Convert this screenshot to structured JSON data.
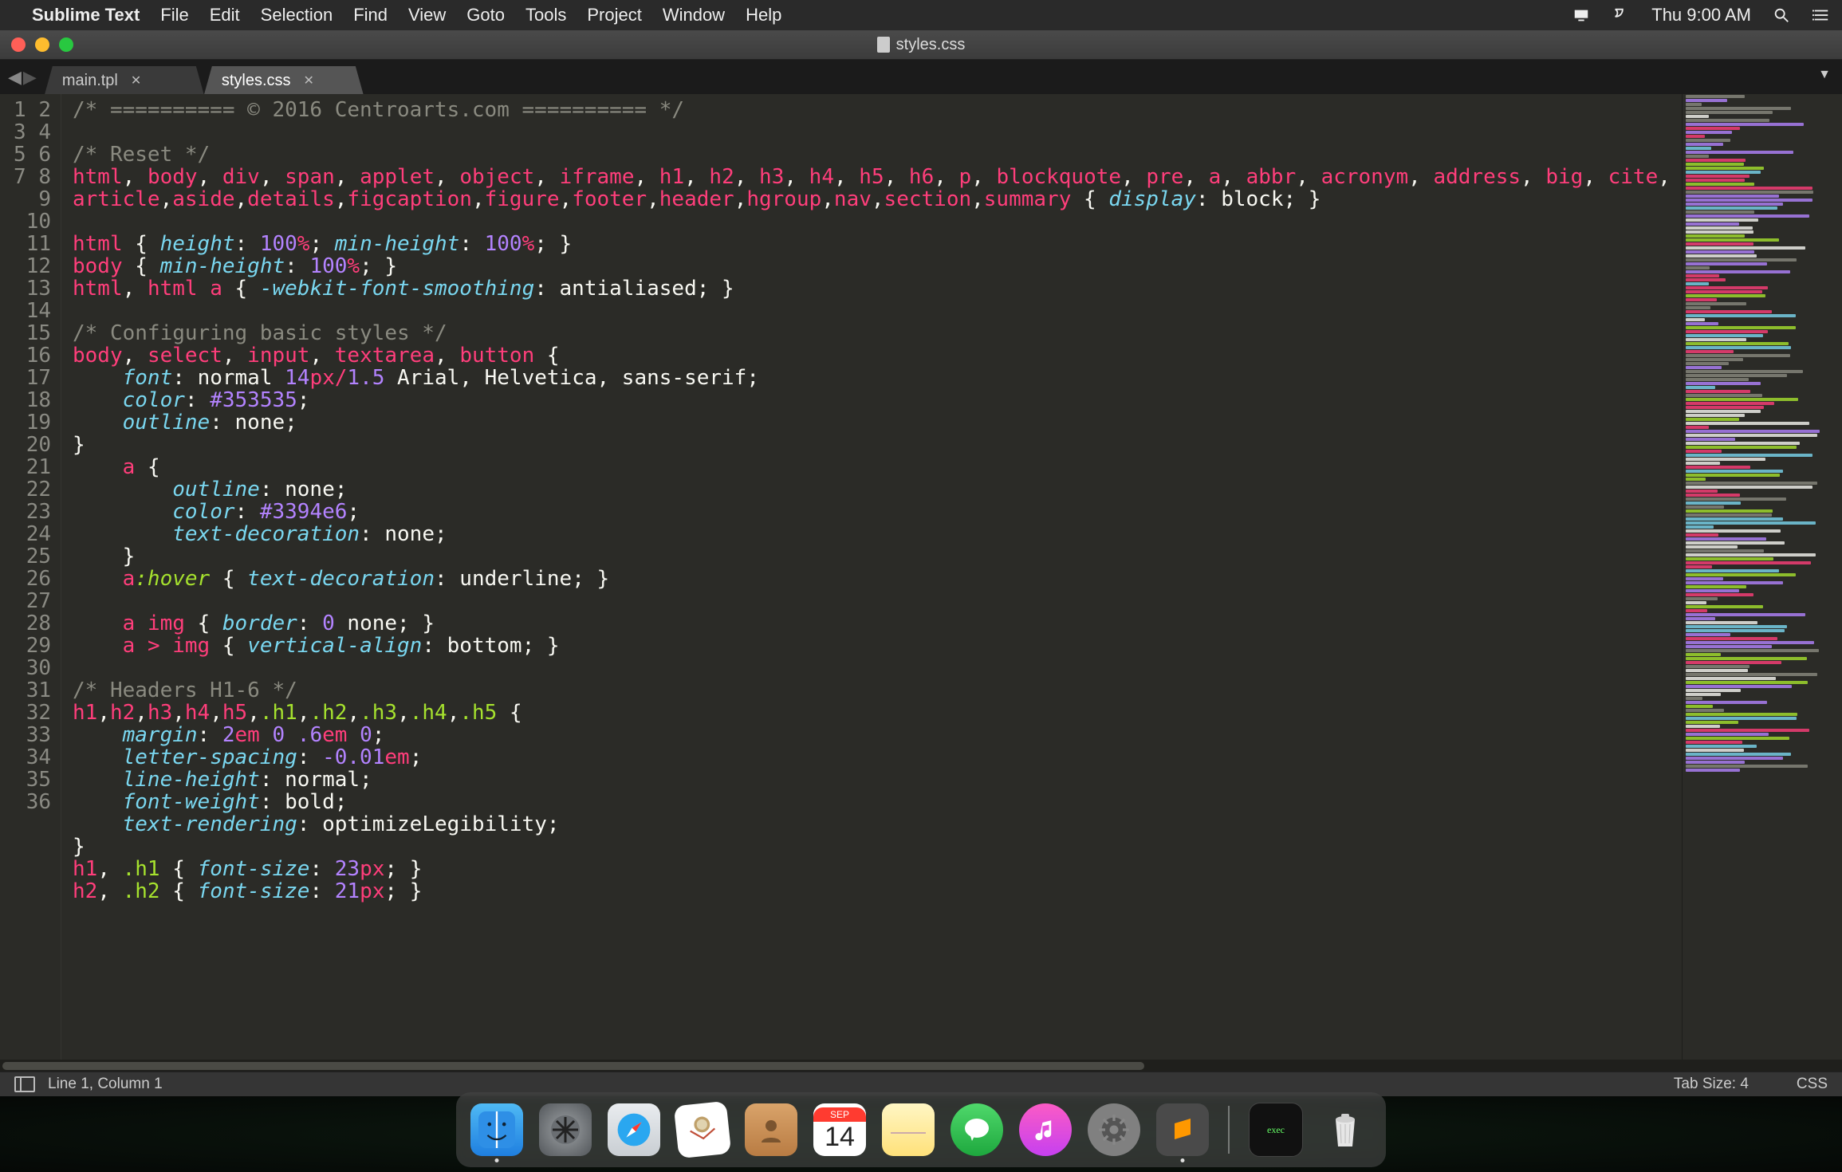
{
  "menubar": {
    "app_name": "Sublime Text",
    "items": [
      "File",
      "Edit",
      "Selection",
      "Find",
      "View",
      "Goto",
      "Tools",
      "Project",
      "Window",
      "Help"
    ],
    "clock": "Thu 9:00 AM"
  },
  "window": {
    "title_filename": "styles.css"
  },
  "tabs": [
    {
      "label": "main.tpl",
      "active": false
    },
    {
      "label": "styles.css",
      "active": true
    }
  ],
  "gutter": {
    "start": 1,
    "end": 36
  },
  "code_lines": [
    {
      "t": "comment",
      "text": "/* ========== © 2016 Centroarts.com ========== */"
    },
    {
      "t": "blank",
      "text": ""
    },
    {
      "t": "comment",
      "text": "/* Reset */"
    },
    {
      "t": "raw",
      "html": "<span class='sel'>html</span><span class='pn'>, </span><span class='sel'>body</span><span class='pn'>, </span><span class='sel'>div</span><span class='pn'>, </span><span class='sel'>span</span><span class='pn'>, </span><span class='sel'>applet</span><span class='pn'>, </span><span class='sel'>object</span><span class='pn'>, </span><span class='sel'>iframe</span><span class='pn'>, </span><span class='sel'>h1</span><span class='pn'>, </span><span class='sel'>h2</span><span class='pn'>, </span><span class='sel'>h3</span><span class='pn'>, </span><span class='sel'>h4</span><span class='pn'>, </span><span class='sel'>h5</span><span class='pn'>, </span><span class='sel'>h6</span><span class='pn'>, </span><span class='sel'>p</span><span class='pn'>, </span><span class='sel'>blockquote</span><span class='pn'>, </span><span class='sel'>pre</span><span class='pn'>, </span><span class='sel'>a</span><span class='pn'>, </span><span class='sel'>abbr</span><span class='pn'>, </span><span class='sel'>acronym</span><span class='pn'>, </span><span class='sel'>address</span><span class='pn'>, </span><span class='sel'>big</span><span class='pn'>, </span><span class='sel'>cite</span><span class='pn'>, </span><span class='sel'>code</span><span class='pn'>, </span>"
    },
    {
      "t": "raw",
      "html": "<span class='sel'>article</span><span class='pn'>,</span><span class='sel'>aside</span><span class='pn'>,</span><span class='sel'>details</span><span class='pn'>,</span><span class='sel'>figcaption</span><span class='pn'>,</span><span class='sel'>figure</span><span class='pn'>,</span><span class='sel'>footer</span><span class='pn'>,</span><span class='sel'>header</span><span class='pn'>,</span><span class='sel'>hgroup</span><span class='pn'>,</span><span class='sel'>nav</span><span class='pn'>,</span><span class='sel'>section</span><span class='pn'>,</span><span class='sel'>summary</span> <span class='pn'>{ </span><span class='prop'>display</span><span class='pn'>: </span><span class='val'>block</span><span class='pn'>; }</span>"
    },
    {
      "t": "blank",
      "text": ""
    },
    {
      "t": "raw",
      "html": "<span class='sel'>html</span> <span class='pn'>{ </span><span class='prop'>height</span><span class='pn'>: </span><span class='num'>100</span><span class='unit'>%</span><span class='pn'>; </span><span class='prop'>min-height</span><span class='pn'>: </span><span class='num'>100</span><span class='unit'>%</span><span class='pn'>; }</span>"
    },
    {
      "t": "raw",
      "html": "<span class='sel'>body</span> <span class='pn'>{ </span><span class='prop'>min-height</span><span class='pn'>: </span><span class='num'>100</span><span class='unit'>%</span><span class='pn'>; }</span>"
    },
    {
      "t": "raw",
      "html": "<span class='sel'>html</span><span class='pn'>, </span><span class='sel'>html</span> <span class='sel'>a</span> <span class='pn'>{ </span><span class='prop'>-webkit-font-smoothing</span><span class='pn'>: </span><span class='val'>antialiased</span><span class='pn'>; }</span>"
    },
    {
      "t": "blank",
      "text": ""
    },
    {
      "t": "comment",
      "text": "/* Configuring basic styles */"
    },
    {
      "t": "raw",
      "html": "<span class='sel'>body</span><span class='pn'>, </span><span class='sel'>select</span><span class='pn'>, </span><span class='sel'>input</span><span class='pn'>, </span><span class='sel'>textarea</span><span class='pn'>, </span><span class='sel'>button</span> <span class='pn'>{</span>"
    },
    {
      "t": "raw",
      "html": "    <span class='prop'>font</span><span class='pn'>: </span><span class='val'>normal </span><span class='num'>14</span><span class='unit'>px</span><span class='op'>/</span><span class='num'>1.5</span><span class='val'> Arial, Helvetica, sans-serif</span><span class='pn'>;</span>"
    },
    {
      "t": "raw",
      "html": "    <span class='prop'>color</span><span class='pn'>: </span><span class='hex'>#353535</span><span class='pn'>;</span>"
    },
    {
      "t": "raw",
      "html": "    <span class='prop'>outline</span><span class='pn'>: </span><span class='val'>none</span><span class='pn'>;</span>"
    },
    {
      "t": "raw",
      "html": "<span class='pn'>}</span>"
    },
    {
      "t": "raw",
      "html": "    <span class='sel'>a</span> <span class='pn'>{</span>"
    },
    {
      "t": "raw",
      "html": "        <span class='prop'>outline</span><span class='pn'>: </span><span class='val'>none</span><span class='pn'>;</span>"
    },
    {
      "t": "raw",
      "html": "        <span class='prop'>color</span><span class='pn'>: </span><span class='hex'>#3394e6</span><span class='pn'>;</span>"
    },
    {
      "t": "raw",
      "html": "        <span class='prop'>text-decoration</span><span class='pn'>: </span><span class='val'>none</span><span class='pn'>;</span>"
    },
    {
      "t": "raw",
      "html": "    <span class='pn'>}</span>"
    },
    {
      "t": "raw",
      "html": "    <span class='sel'>a</span><span class='pc'>:hover</span> <span class='pn'>{ </span><span class='prop'>text-decoration</span><span class='pn'>: </span><span class='val'>underline</span><span class='pn'>; }</span>"
    },
    {
      "t": "blank",
      "text": ""
    },
    {
      "t": "raw",
      "html": "    <span class='sel'>a</span> <span class='sel'>img</span> <span class='pn'>{ </span><span class='prop'>border</span><span class='pn'>: </span><span class='num'>0</span><span class='val'> none</span><span class='pn'>; }</span>"
    },
    {
      "t": "raw",
      "html": "    <span class='sel'>a</span> <span class='op'>&gt;</span> <span class='sel'>img</span> <span class='pn'>{ </span><span class='prop'>vertical-align</span><span class='pn'>: </span><span class='val'>bottom</span><span class='pn'>; }</span>"
    },
    {
      "t": "blank",
      "text": ""
    },
    {
      "t": "comment",
      "text": "/* Headers H1-6 */"
    },
    {
      "t": "raw",
      "html": "<span class='sel'>h1</span><span class='pn'>,</span><span class='sel'>h2</span><span class='pn'>,</span><span class='sel'>h3</span><span class='pn'>,</span><span class='sel'>h4</span><span class='pn'>,</span><span class='sel'>h5</span><span class='pn'>,</span><span class='cls'>.h1</span><span class='pn'>,</span><span class='cls'>.h2</span><span class='pn'>,</span><span class='cls'>.h3</span><span class='pn'>,</span><span class='cls'>.h4</span><span class='pn'>,</span><span class='cls'>.h5</span> <span class='pn'>{</span>"
    },
    {
      "t": "raw",
      "html": "    <span class='prop'>margin</span><span class='pn'>: </span><span class='num'>2</span><span class='unit'>em</span> <span class='num'>0</span> <span class='num'>.6</span><span class='unit'>em</span> <span class='num'>0</span><span class='pn'>;</span>"
    },
    {
      "t": "raw",
      "html": "    <span class='prop'>letter-spacing</span><span class='pn'>: </span><span class='num'>-0.01</span><span class='unit'>em</span><span class='pn'>;</span>"
    },
    {
      "t": "raw",
      "html": "    <span class='prop'>line-height</span><span class='pn'>: </span><span class='val'>normal</span><span class='pn'>;</span>"
    },
    {
      "t": "raw",
      "html": "    <span class='prop'>font-weight</span><span class='pn'>: </span><span class='val'>bold</span><span class='pn'>;</span>"
    },
    {
      "t": "raw",
      "html": "    <span class='prop'>text-rendering</span><span class='pn'>: </span><span class='val'>optimizeLegibility</span><span class='pn'>;</span>"
    },
    {
      "t": "raw",
      "html": "<span class='pn'>}</span>"
    },
    {
      "t": "raw",
      "html": "<span class='sel'>h1</span><span class='pn'>, </span><span class='cls'>.h1</span> <span class='pn'>{ </span><span class='prop'>font-size</span><span class='pn'>: </span><span class='num'>23</span><span class='unit'>px</span><span class='pn'>; }</span>"
    },
    {
      "t": "raw",
      "html": "<span class='sel'>h2</span><span class='pn'>, </span><span class='cls'>.h2</span> <span class='pn'>{ </span><span class='prop'>font-size</span><span class='pn'>: </span><span class='num'>21</span><span class='unit'>px</span><span class='pn'>; }</span>"
    }
  ],
  "status": {
    "position": "Line 1, Column 1",
    "indent": "Tab Size: 4",
    "syntax": "CSS"
  },
  "calendar": {
    "month": "SEP",
    "day": "14"
  },
  "dock": {
    "apps": [
      "finder",
      "launchpad",
      "safari",
      "mail",
      "contacts",
      "calendar",
      "notes",
      "messages",
      "music",
      "system-preferences",
      "sublime-text"
    ],
    "right": [
      "exec-tile",
      "trash"
    ],
    "running": [
      "finder",
      "sublime-text"
    ]
  },
  "exec_label": "exec"
}
